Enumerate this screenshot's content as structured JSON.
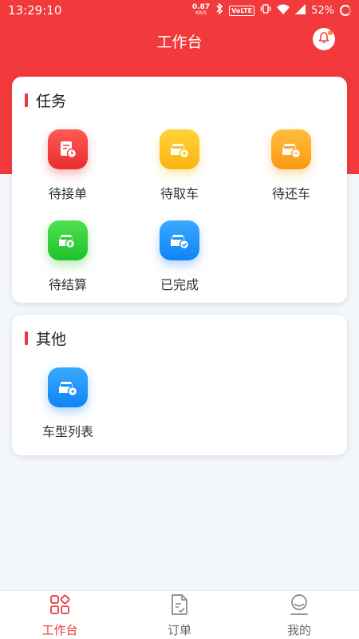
{
  "status_bar": {
    "time": "13:29:10",
    "net_speed": "0.87",
    "net_unit": "KB/S",
    "volte": "VoLTE",
    "battery": "52%"
  },
  "header": {
    "title": "工作台",
    "bell_icon": "bell-icon"
  },
  "tasks": {
    "title": "任务",
    "items": [
      {
        "label": "待接单",
        "icon": "order-clock-icon",
        "color": "#ef3a3b"
      },
      {
        "label": "待取车",
        "icon": "car-add-icon",
        "color": "#fcc21e"
      },
      {
        "label": "待还车",
        "icon": "car-minus-icon",
        "color": "#fca424"
      },
      {
        "label": "待结算",
        "icon": "car-settle-icon",
        "color": "#28c937"
      },
      {
        "label": "已完成",
        "icon": "car-check-icon",
        "color": "#1690f8"
      }
    ]
  },
  "other": {
    "title": "其他",
    "items": [
      {
        "label": "车型列表",
        "icon": "car-list-icon",
        "color": "#1690f8"
      }
    ]
  },
  "tabbar": {
    "items": [
      {
        "label": "工作台",
        "icon": "grid-icon",
        "active": true
      },
      {
        "label": "订单",
        "icon": "document-icon",
        "active": false
      },
      {
        "label": "我的",
        "icon": "user-icon",
        "active": false
      }
    ]
  },
  "colors": {
    "brand_red": "#f23a3c",
    "background": "#f3f6fa"
  }
}
